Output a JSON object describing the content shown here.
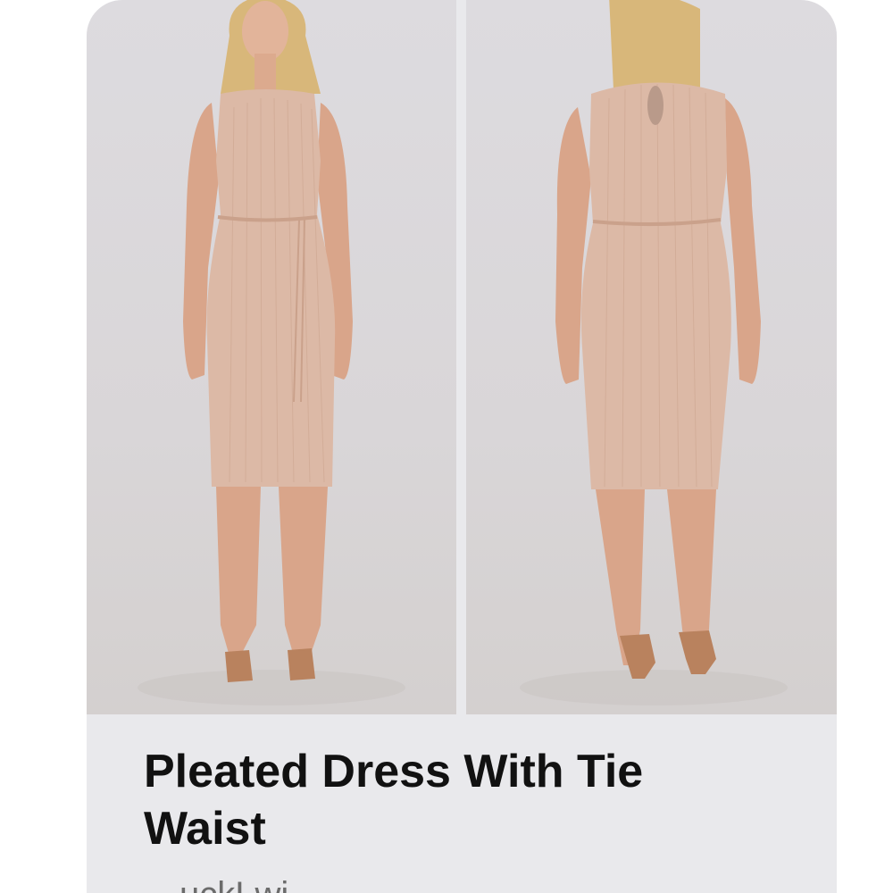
{
  "product": {
    "title": "Pleated Dress With Tie Waist",
    "brand_partial": "…uckLwi…"
  },
  "images": [
    {
      "name": "front view"
    },
    {
      "name": "back view"
    }
  ],
  "colors": {
    "card_bg": "#e9e9ec",
    "dress": "#dcb9a6",
    "skin": "#d9a58a",
    "hair": "#d8b77a",
    "sandal": "#b9825e"
  }
}
